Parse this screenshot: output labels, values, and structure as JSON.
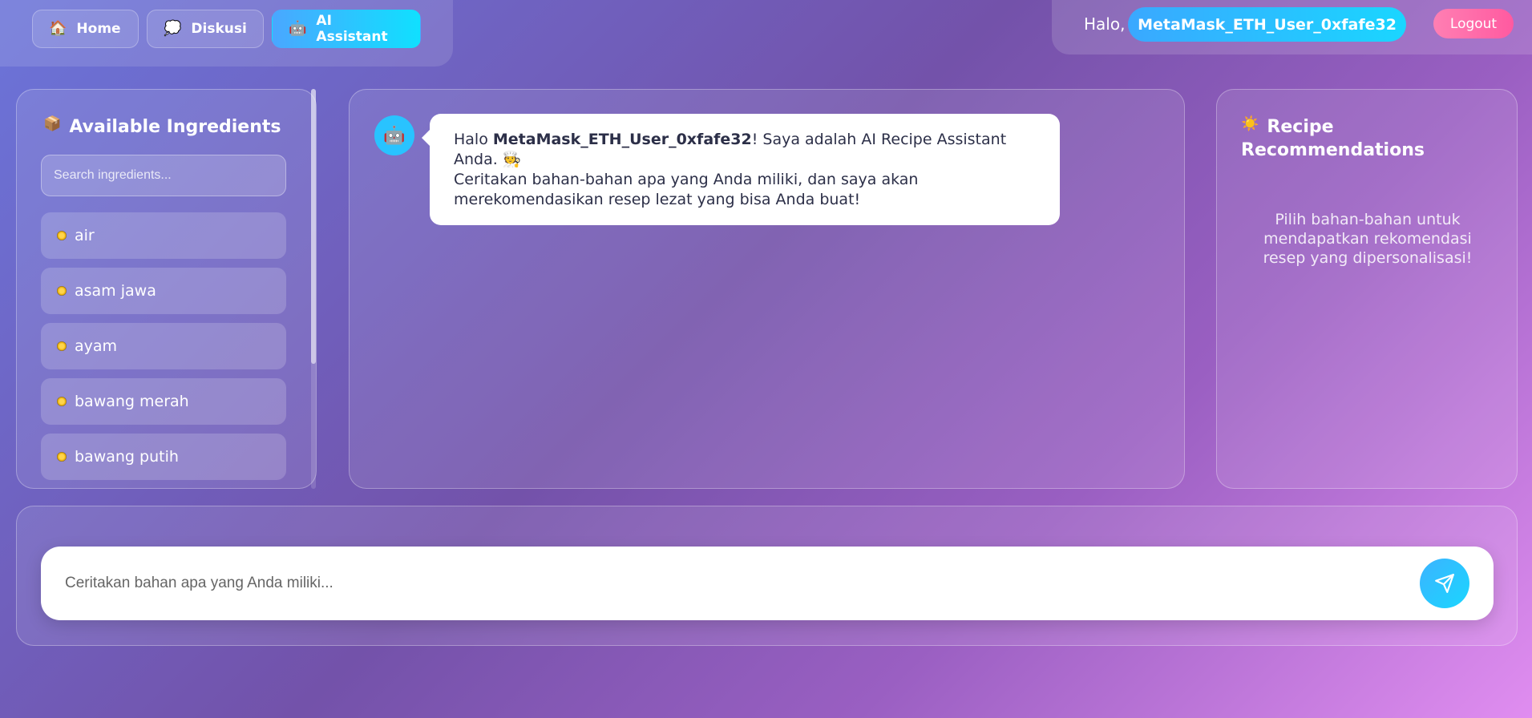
{
  "nav": {
    "home_icon": "house-icon",
    "home_label": "Home",
    "diskusi_icon": "speech-bubble-icon",
    "diskusi_label": "Diskusi",
    "ai_icon": "robot-icon",
    "ai_label": "AI Assistant"
  },
  "user": {
    "greeting": "Halo,",
    "name": "MetaMask_ETH_User_0xfafe32",
    "logout_label": "Logout"
  },
  "ingredients_panel": {
    "icon": "package-icon",
    "title": "Available Ingredients",
    "search_placeholder": "Search ingredients...",
    "items": [
      "air",
      "asam jawa",
      "ayam",
      "bawang merah",
      "bawang putih"
    ]
  },
  "chat": {
    "avatar_icon": "robot-icon",
    "message": {
      "prefix": "Halo ",
      "username": "MetaMask_ETH_User_0xfafe32",
      "line1_rest": "! Saya adalah AI Recipe Assistant Anda.",
      "chef_icon": "chef-icon",
      "line2": "Ceritakan bahan-bahan apa yang Anda miliki, dan saya akan merekomendasikan resep lezat yang bisa Anda buat!"
    }
  },
  "recommendations": {
    "icon": "sun-icon",
    "title_line1": "Recipe",
    "title_line2": "Recommendations",
    "empty_text": "Pilih bahan-bahan untuk mendapatkan rekomendasi resep yang dipersonalisasi!"
  },
  "input": {
    "placeholder": "Ceritakan bahan apa yang Anda miliki...",
    "send_icon": "send-icon"
  },
  "colors": {
    "accent": "#1ad6ff",
    "logout": "#ff5aa0"
  }
}
